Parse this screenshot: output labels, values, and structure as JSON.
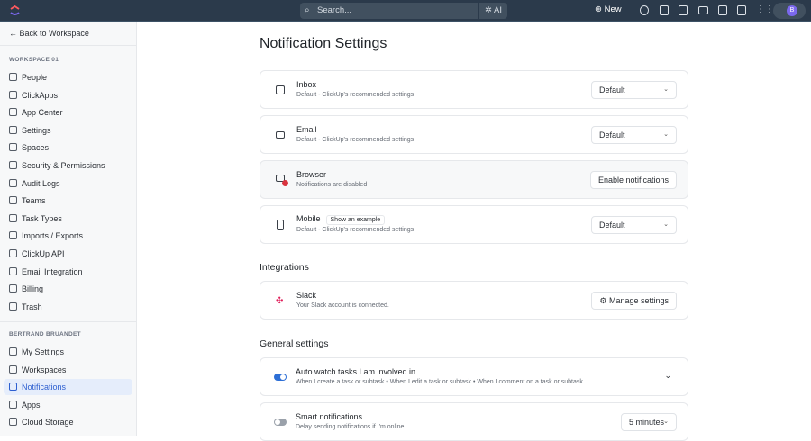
{
  "topbar": {
    "search_placeholder": "Search...",
    "ai_label": "AI",
    "new_label": "New",
    "avatar_initial": "B"
  },
  "sidebar": {
    "back_label": "Back to Workspace",
    "workspace_label": "WORKSPACE 01",
    "workspace_items": [
      "People",
      "ClickApps",
      "App Center",
      "Settings",
      "Spaces",
      "Security & Permissions",
      "Audit Logs",
      "Teams",
      "Task Types",
      "Imports / Exports",
      "ClickUp API",
      "Email Integration",
      "Billing",
      "Trash"
    ],
    "user_label": "BERTRAND BRUANDET",
    "user_items": [
      "My Settings",
      "Workspaces",
      "Notifications",
      "Apps",
      "Cloud Storage"
    ],
    "active_item": "Notifications"
  },
  "main": {
    "title": "Notification Settings",
    "channels": [
      {
        "title": "Inbox",
        "desc": "Default - ClickUp's recommended settings",
        "control": "Default"
      },
      {
        "title": "Email",
        "desc": "Default - ClickUp's recommended settings",
        "control": "Default"
      },
      {
        "title": "Browser",
        "desc": "Notifications are disabled",
        "control": "Enable notifications"
      },
      {
        "title": "Mobile",
        "tag": "Show an example",
        "desc": "Default - ClickUp's recommended settings",
        "control": "Default"
      }
    ],
    "integrations_heading": "Integrations",
    "slack": {
      "title": "Slack",
      "desc": "Your Slack account is connected.",
      "button": "Manage settings"
    },
    "general_heading": "General settings",
    "general": [
      {
        "title": "Auto watch tasks I am involved in",
        "desc": "When I create a task or subtask • When I edit a task or subtask • When I comment on a task or subtask",
        "enabled": true
      },
      {
        "title": "Smart notifications",
        "desc": "Delay sending notifications if I'm online",
        "enabled": false,
        "control": "5 minutes"
      }
    ]
  },
  "colors": {
    "topbar": "#2b3a4b",
    "accent": "#2d5fd0",
    "toggle_on": "#2d6fd6"
  }
}
